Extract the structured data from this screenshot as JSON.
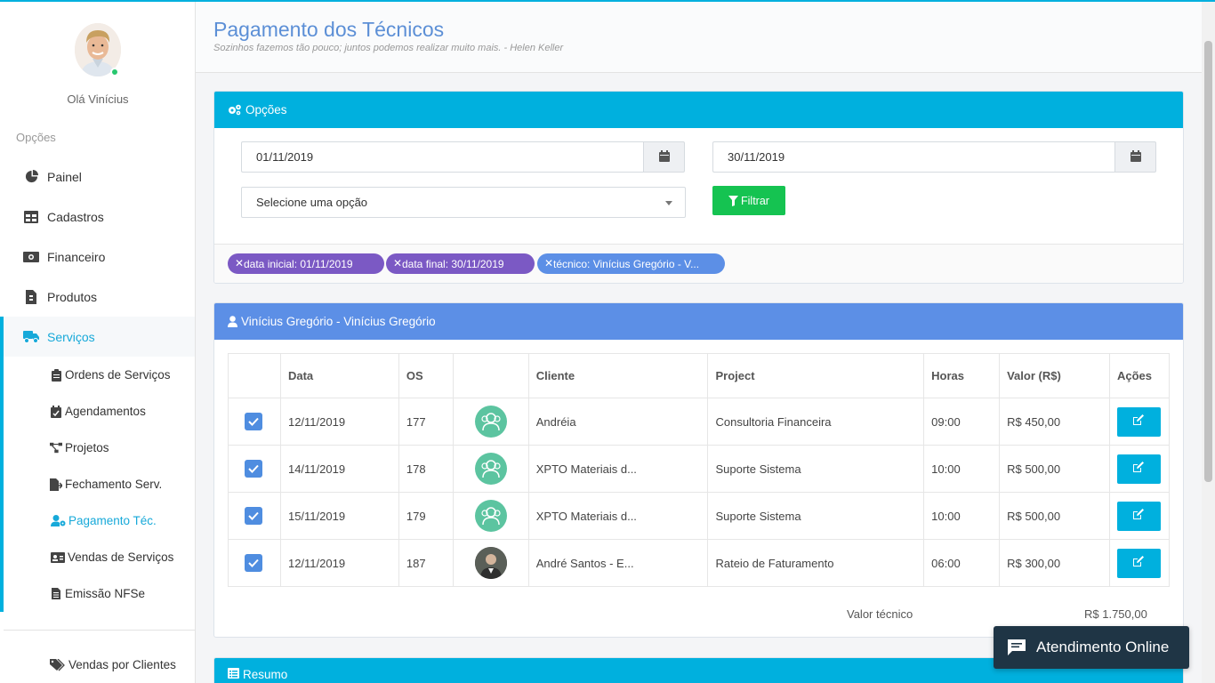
{
  "header": {
    "title": "Pagamento dos Técnicos",
    "quote": "Sozinhos fazemos tão pouco; juntos podemos realizar muito mais. - Helen Keller"
  },
  "sidebar": {
    "greeting": "Olá Vinícius",
    "section_label": "Opções",
    "items": [
      {
        "label": "Painel",
        "icon": "pie-chart-icon"
      },
      {
        "label": "Cadastros",
        "icon": "table-icon"
      },
      {
        "label": "Financeiro",
        "icon": "money-icon"
      },
      {
        "label": "Produtos",
        "icon": "file-icon"
      },
      {
        "label": "Serviços",
        "icon": "truck-icon",
        "active": true
      }
    ],
    "subitems": [
      {
        "label": "Ordens de Serviços",
        "icon": "clipboard-icon"
      },
      {
        "label": "Agendamentos",
        "icon": "calendar-check-icon"
      },
      {
        "label": "Projetos",
        "icon": "project-diagram-icon"
      },
      {
        "label": "Fechamento Serv.",
        "icon": "file-export-icon"
      },
      {
        "label": "Pagamento Téc.",
        "icon": "user-cog-icon",
        "active": true
      },
      {
        "label": "Vendas de Serviços",
        "icon": "id-card-icon"
      },
      {
        "label": "Emissão NFSe",
        "icon": "file-alt-icon"
      }
    ],
    "extra": {
      "label": "Vendas por Clientes",
      "icon": "tags-icon"
    }
  },
  "options_panel": {
    "title": "Opções",
    "date_start": "01/11/2019",
    "date_end": "30/11/2019",
    "select_placeholder": "Selecione uma opção",
    "filter_label": "Filtrar",
    "chips": [
      "data inicial: 01/11/2019",
      "data final: 30/11/2019",
      "técnico: Vinícius Gregório - V..."
    ]
  },
  "tech_panel": {
    "title": "Vinícius Gregório - Vinícius Gregório",
    "columns": [
      "",
      "Data",
      "OS",
      "",
      "Cliente",
      "Project",
      "Horas",
      "Valor (R$)",
      "Ações"
    ],
    "rows": [
      {
        "date": "12/11/2019",
        "os": "177",
        "client": "Andréia",
        "project": "Consultoria Financeira",
        "hours": "09:00",
        "value": "R$ 450,00"
      },
      {
        "date": "14/11/2019",
        "os": "178",
        "client": "XPTO Materiais d...",
        "project": "Suporte Sistema",
        "hours": "10:00",
        "value": "R$ 500,00"
      },
      {
        "date": "15/11/2019",
        "os": "179",
        "client": "XPTO Materiais d...",
        "project": "Suporte Sistema",
        "hours": "10:00",
        "value": "R$ 500,00"
      },
      {
        "date": "12/11/2019",
        "os": "187",
        "client": "André Santos - E...",
        "project": "Rateio de Faturamento",
        "hours": "06:00",
        "value": "R$ 300,00"
      }
    ],
    "total_label": "Valor técnico",
    "total_value": "R$ 1.750,00"
  },
  "resumo_panel": {
    "title": "Resumo"
  },
  "chat": {
    "label": "Atendimento Online"
  },
  "colors": {
    "accent": "#00b0de",
    "blue": "#5c8fe6",
    "purple": "#7b59c4",
    "green": "#15c351"
  }
}
